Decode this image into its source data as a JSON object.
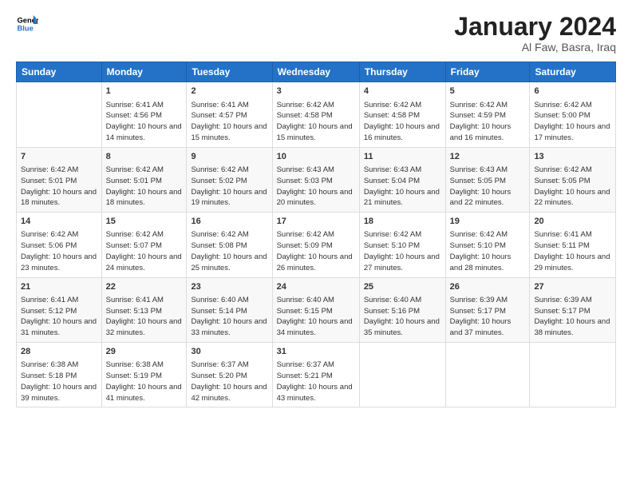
{
  "logo": {
    "line1": "General",
    "line2": "Blue"
  },
  "title": "January 2024",
  "location": "Al Faw, Basra, Iraq",
  "headers": [
    "Sunday",
    "Monday",
    "Tuesday",
    "Wednesday",
    "Thursday",
    "Friday",
    "Saturday"
  ],
  "weeks": [
    [
      {
        "day": "",
        "sunrise": "",
        "sunset": "",
        "daylight": ""
      },
      {
        "day": "1",
        "sunrise": "Sunrise: 6:41 AM",
        "sunset": "Sunset: 4:56 PM",
        "daylight": "Daylight: 10 hours and 14 minutes."
      },
      {
        "day": "2",
        "sunrise": "Sunrise: 6:41 AM",
        "sunset": "Sunset: 4:57 PM",
        "daylight": "Daylight: 10 hours and 15 minutes."
      },
      {
        "day": "3",
        "sunrise": "Sunrise: 6:42 AM",
        "sunset": "Sunset: 4:58 PM",
        "daylight": "Daylight: 10 hours and 15 minutes."
      },
      {
        "day": "4",
        "sunrise": "Sunrise: 6:42 AM",
        "sunset": "Sunset: 4:58 PM",
        "daylight": "Daylight: 10 hours and 16 minutes."
      },
      {
        "day": "5",
        "sunrise": "Sunrise: 6:42 AM",
        "sunset": "Sunset: 4:59 PM",
        "daylight": "Daylight: 10 hours and 16 minutes."
      },
      {
        "day": "6",
        "sunrise": "Sunrise: 6:42 AM",
        "sunset": "Sunset: 5:00 PM",
        "daylight": "Daylight: 10 hours and 17 minutes."
      }
    ],
    [
      {
        "day": "7",
        "sunrise": "Sunrise: 6:42 AM",
        "sunset": "Sunset: 5:01 PM",
        "daylight": "Daylight: 10 hours and 18 minutes."
      },
      {
        "day": "8",
        "sunrise": "Sunrise: 6:42 AM",
        "sunset": "Sunset: 5:01 PM",
        "daylight": "Daylight: 10 hours and 18 minutes."
      },
      {
        "day": "9",
        "sunrise": "Sunrise: 6:42 AM",
        "sunset": "Sunset: 5:02 PM",
        "daylight": "Daylight: 10 hours and 19 minutes."
      },
      {
        "day": "10",
        "sunrise": "Sunrise: 6:43 AM",
        "sunset": "Sunset: 5:03 PM",
        "daylight": "Daylight: 10 hours and 20 minutes."
      },
      {
        "day": "11",
        "sunrise": "Sunrise: 6:43 AM",
        "sunset": "Sunset: 5:04 PM",
        "daylight": "Daylight: 10 hours and 21 minutes."
      },
      {
        "day": "12",
        "sunrise": "Sunrise: 6:43 AM",
        "sunset": "Sunset: 5:05 PM",
        "daylight": "Daylight: 10 hours and 22 minutes."
      },
      {
        "day": "13",
        "sunrise": "Sunrise: 6:42 AM",
        "sunset": "Sunset: 5:05 PM",
        "daylight": "Daylight: 10 hours and 22 minutes."
      }
    ],
    [
      {
        "day": "14",
        "sunrise": "Sunrise: 6:42 AM",
        "sunset": "Sunset: 5:06 PM",
        "daylight": "Daylight: 10 hours and 23 minutes."
      },
      {
        "day": "15",
        "sunrise": "Sunrise: 6:42 AM",
        "sunset": "Sunset: 5:07 PM",
        "daylight": "Daylight: 10 hours and 24 minutes."
      },
      {
        "day": "16",
        "sunrise": "Sunrise: 6:42 AM",
        "sunset": "Sunset: 5:08 PM",
        "daylight": "Daylight: 10 hours and 25 minutes."
      },
      {
        "day": "17",
        "sunrise": "Sunrise: 6:42 AM",
        "sunset": "Sunset: 5:09 PM",
        "daylight": "Daylight: 10 hours and 26 minutes."
      },
      {
        "day": "18",
        "sunrise": "Sunrise: 6:42 AM",
        "sunset": "Sunset: 5:10 PM",
        "daylight": "Daylight: 10 hours and 27 minutes."
      },
      {
        "day": "19",
        "sunrise": "Sunrise: 6:42 AM",
        "sunset": "Sunset: 5:10 PM",
        "daylight": "Daylight: 10 hours and 28 minutes."
      },
      {
        "day": "20",
        "sunrise": "Sunrise: 6:41 AM",
        "sunset": "Sunset: 5:11 PM",
        "daylight": "Daylight: 10 hours and 29 minutes."
      }
    ],
    [
      {
        "day": "21",
        "sunrise": "Sunrise: 6:41 AM",
        "sunset": "Sunset: 5:12 PM",
        "daylight": "Daylight: 10 hours and 31 minutes."
      },
      {
        "day": "22",
        "sunrise": "Sunrise: 6:41 AM",
        "sunset": "Sunset: 5:13 PM",
        "daylight": "Daylight: 10 hours and 32 minutes."
      },
      {
        "day": "23",
        "sunrise": "Sunrise: 6:40 AM",
        "sunset": "Sunset: 5:14 PM",
        "daylight": "Daylight: 10 hours and 33 minutes."
      },
      {
        "day": "24",
        "sunrise": "Sunrise: 6:40 AM",
        "sunset": "Sunset: 5:15 PM",
        "daylight": "Daylight: 10 hours and 34 minutes."
      },
      {
        "day": "25",
        "sunrise": "Sunrise: 6:40 AM",
        "sunset": "Sunset: 5:16 PM",
        "daylight": "Daylight: 10 hours and 35 minutes."
      },
      {
        "day": "26",
        "sunrise": "Sunrise: 6:39 AM",
        "sunset": "Sunset: 5:17 PM",
        "daylight": "Daylight: 10 hours and 37 minutes."
      },
      {
        "day": "27",
        "sunrise": "Sunrise: 6:39 AM",
        "sunset": "Sunset: 5:17 PM",
        "daylight": "Daylight: 10 hours and 38 minutes."
      }
    ],
    [
      {
        "day": "28",
        "sunrise": "Sunrise: 6:38 AM",
        "sunset": "Sunset: 5:18 PM",
        "daylight": "Daylight: 10 hours and 39 minutes."
      },
      {
        "day": "29",
        "sunrise": "Sunrise: 6:38 AM",
        "sunset": "Sunset: 5:19 PM",
        "daylight": "Daylight: 10 hours and 41 minutes."
      },
      {
        "day": "30",
        "sunrise": "Sunrise: 6:37 AM",
        "sunset": "Sunset: 5:20 PM",
        "daylight": "Daylight: 10 hours and 42 minutes."
      },
      {
        "day": "31",
        "sunrise": "Sunrise: 6:37 AM",
        "sunset": "Sunset: 5:21 PM",
        "daylight": "Daylight: 10 hours and 43 minutes."
      },
      {
        "day": "",
        "sunrise": "",
        "sunset": "",
        "daylight": ""
      },
      {
        "day": "",
        "sunrise": "",
        "sunset": "",
        "daylight": ""
      },
      {
        "day": "",
        "sunrise": "",
        "sunset": "",
        "daylight": ""
      }
    ]
  ]
}
